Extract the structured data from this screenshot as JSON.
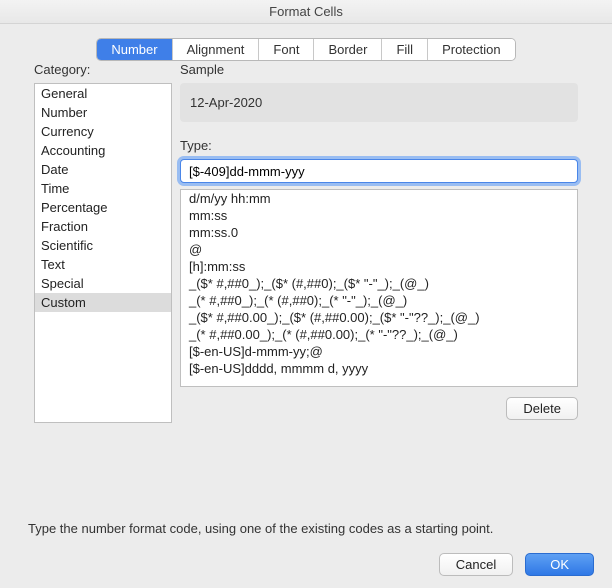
{
  "window": {
    "title": "Format Cells"
  },
  "tabs": [
    {
      "label": "Number",
      "active": true
    },
    {
      "label": "Alignment",
      "active": false
    },
    {
      "label": "Font",
      "active": false
    },
    {
      "label": "Border",
      "active": false
    },
    {
      "label": "Fill",
      "active": false
    },
    {
      "label": "Protection",
      "active": false
    }
  ],
  "category": {
    "label": "Category:",
    "items": [
      {
        "text": "General",
        "selected": false
      },
      {
        "text": "Number",
        "selected": false
      },
      {
        "text": "Currency",
        "selected": false
      },
      {
        "text": "Accounting",
        "selected": false
      },
      {
        "text": "Date",
        "selected": false
      },
      {
        "text": "Time",
        "selected": false
      },
      {
        "text": "Percentage",
        "selected": false
      },
      {
        "text": "Fraction",
        "selected": false
      },
      {
        "text": "Scientific",
        "selected": false
      },
      {
        "text": "Text",
        "selected": false
      },
      {
        "text": "Special",
        "selected": false
      },
      {
        "text": "Custom",
        "selected": true
      }
    ]
  },
  "sample": {
    "label": "Sample",
    "value": "12-Apr-2020"
  },
  "type": {
    "label": "Type:",
    "value": "[$-409]dd-mmm-yyy",
    "list": [
      "d/m/yy hh:mm",
      "mm:ss",
      "mm:ss.0",
      "@",
      "[h]:mm:ss",
      "_($* #,##0_);_($* (#,##0);_($* \"-\"_);_(@_)",
      "_(* #,##0_);_(* (#,##0);_(* \"-\"_);_(@_)",
      "_($* #,##0.00_);_($* (#,##0.00);_($* \"-\"??_);_(@_)",
      "_(* #,##0.00_);_(* (#,##0.00);_(* \"-\"??_);_(@_)",
      "[$-en-US]d-mmm-yy;@",
      "[$-en-US]dddd, mmmm d, yyyy"
    ]
  },
  "buttons": {
    "delete": "Delete",
    "cancel": "Cancel",
    "ok": "OK"
  },
  "hint": "Type the number format code, using one of the existing codes as a starting point."
}
